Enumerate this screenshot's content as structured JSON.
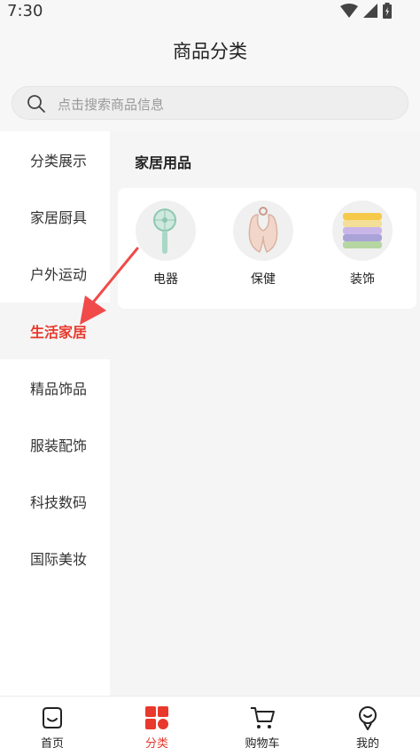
{
  "status_bar": {
    "time": "7:30"
  },
  "header": {
    "title": "商品分类"
  },
  "search": {
    "placeholder": "点击搜索商品信息"
  },
  "sidebar": {
    "items": [
      {
        "label": "分类展示",
        "active": false
      },
      {
        "label": "家居厨具",
        "active": false
      },
      {
        "label": "户外运动",
        "active": false
      },
      {
        "label": "生活家居",
        "active": true
      },
      {
        "label": "精品饰品",
        "active": false
      },
      {
        "label": "服装配饰",
        "active": false
      },
      {
        "label": "科技数码",
        "active": false
      },
      {
        "label": "国际美妆",
        "active": false
      }
    ]
  },
  "main": {
    "section_title": "家居用品",
    "categories": [
      {
        "label": "电器",
        "icon": "fan-icon"
      },
      {
        "label": "保健",
        "icon": "neck-pillow-icon"
      },
      {
        "label": "装饰",
        "icon": "towel-stack-icon"
      }
    ]
  },
  "bottom_nav": {
    "items": [
      {
        "label": "首页",
        "icon": "home-icon",
        "active": false
      },
      {
        "label": "分类",
        "icon": "category-icon",
        "active": true
      },
      {
        "label": "购物车",
        "icon": "cart-icon",
        "active": false
      },
      {
        "label": "我的",
        "icon": "profile-icon",
        "active": false
      }
    ]
  },
  "colors": {
    "accent": "#e8392c",
    "annotation_arrow": "#f04a4a"
  }
}
